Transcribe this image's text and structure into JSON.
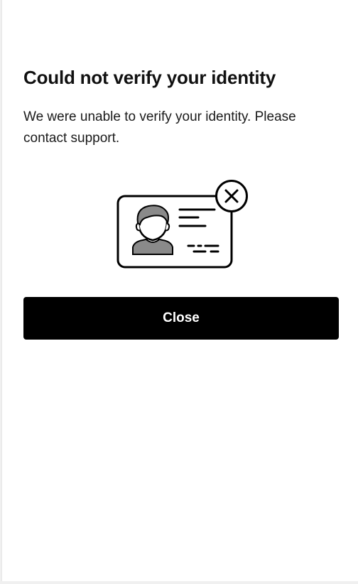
{
  "dialog": {
    "title": "Could not verify your identity",
    "message": "We were unable to verify your identity. Please contact support.",
    "illustration_icon": "id-card-error-icon",
    "close_label": "Close"
  },
  "colors": {
    "button_background": "#000000",
    "button_text": "#ffffff",
    "text": "#111111",
    "background": "#ffffff"
  }
}
